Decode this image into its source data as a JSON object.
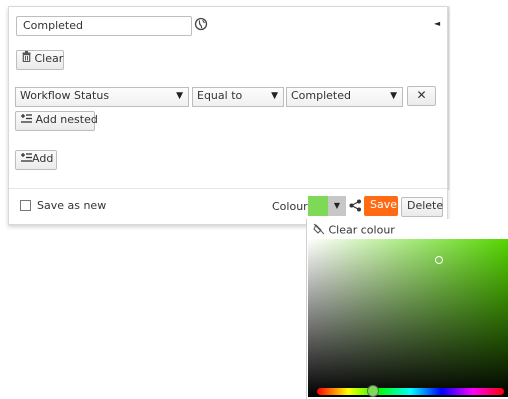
{
  "filter": {
    "name_value": "Completed",
    "clear_label": "Clear",
    "row": {
      "field": "Workflow Status",
      "operator": "Equal to",
      "value": "Completed",
      "remove_symbol": "✕"
    },
    "add_nested_label": "Add nested",
    "add_label": "Add",
    "save_as_new_label": "Save as new",
    "colour_label": "Colour:",
    "selected_colour": "#7ed957",
    "save_label": "Save",
    "delete_label": "Delete"
  },
  "colour_picker": {
    "clear_colour_label": "Clear colour",
    "hue_colour": "#55d600"
  },
  "colors": {
    "save_button": "#ff6a13",
    "accent_green": "#7ed957"
  }
}
